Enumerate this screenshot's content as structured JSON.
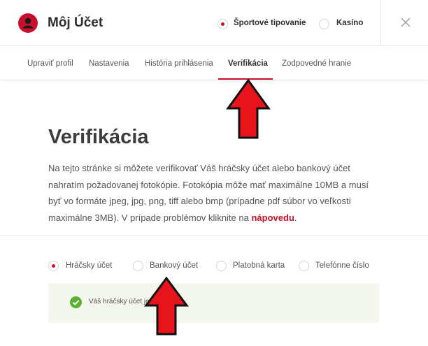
{
  "header": {
    "title": "Môj Účet",
    "avatar_icon": "user-icon",
    "mode_options": [
      {
        "label": "Športové tipovanie",
        "selected": true
      },
      {
        "label": "Kasíno",
        "selected": false
      }
    ],
    "close_icon": "close-icon"
  },
  "tabs": [
    {
      "label": "Upraviť profil",
      "active": false
    },
    {
      "label": "Nastavenia",
      "active": false
    },
    {
      "label": "História prihlásenia",
      "active": false
    },
    {
      "label": "Verifikácia",
      "active": true
    },
    {
      "label": "Zodpovedné hranie",
      "active": false
    }
  ],
  "main": {
    "heading": "Verifikácia",
    "description": "Na tejto stránke si môžete verifikovať Váš hráčsky účet alebo bankový účet nahratím požadovanej fotokópie. Fotokópia môže mať maximálne 10MB a musí byť vo formáte jpeg, jpg, png, tiff alebo bmp (prípadne pdf súbor vo veľkosti maximálne 3MB). V prípade problémov kliknite na",
    "help_link": "nápovedu",
    "description_end": "."
  },
  "verification_options": [
    {
      "label": "Hráčsky účet",
      "selected": true
    },
    {
      "label": "Bankový účet",
      "selected": false
    },
    {
      "label": "Platobná karta",
      "selected": false
    },
    {
      "label": "Telefónne číslo",
      "selected": false
    }
  ],
  "status": {
    "icon": "check-circle-icon",
    "text": "Váš hráčsky účet je v"
  },
  "colors": {
    "accent": "#c8102e",
    "success": "#5cb030",
    "annotation_arrow": "#e8141c"
  }
}
